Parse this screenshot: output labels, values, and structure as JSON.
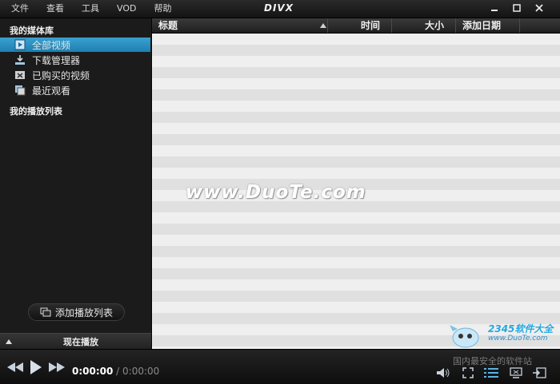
{
  "menu": [
    "文件",
    "查看",
    "工具",
    "VOD",
    "帮助"
  ],
  "logo": "DIVX",
  "window_controls": [
    "minimize-icon",
    "maximize-icon",
    "close-icon"
  ],
  "sidebar": {
    "library_title": "我的媒体库",
    "items": [
      {
        "label": "全部视频",
        "icon": "video-icon",
        "selected": true
      },
      {
        "label": "下载管理器",
        "icon": "download-icon",
        "selected": false
      },
      {
        "label": "已购买的视频",
        "icon": "purchase-icon",
        "selected": false
      },
      {
        "label": "最近观看",
        "icon": "recent-icon",
        "selected": false
      }
    ],
    "playlist_title": "我的播放列表",
    "add_playlist": "添加播放列表",
    "now_playing": "现在播放"
  },
  "table": {
    "columns": [
      "标题",
      "时间",
      "大小",
      "添加日期"
    ],
    "sorted_by": "标题",
    "rows": []
  },
  "watermark": "www.DuoTe.com",
  "stamp": {
    "brand": "2345软件大全",
    "url": "www.DuoTe.com"
  },
  "player": {
    "current_time": "0:00:00",
    "separator": " / ",
    "total_time": "0:00:00",
    "site_tag": "国内最安全的软件站"
  },
  "colors": {
    "accent": "#2a8fc4",
    "background": "#161616",
    "row_alt": "#e0e0e0"
  }
}
